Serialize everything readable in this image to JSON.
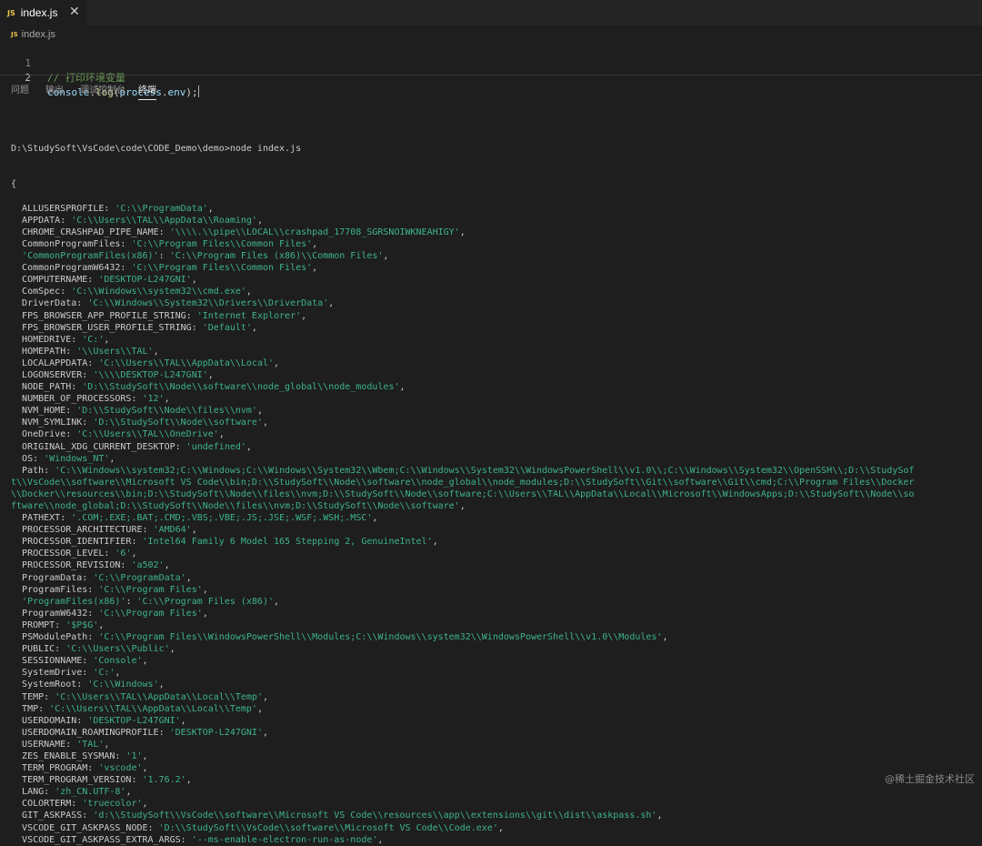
{
  "tab": {
    "badge": "JS",
    "label": "index.js",
    "close": "✕"
  },
  "breadcrumb": {
    "badge": "JS",
    "label": "index.js"
  },
  "editor": {
    "line1_num": "1",
    "line1_text": "// 打印环境变量",
    "line2_num": "2",
    "line2_ident": "console",
    "line2_dot": ".",
    "line2_func": "log",
    "line2_open": "(",
    "line2_arg_obj": "process",
    "line2_arg_dot": ".",
    "line2_arg_prop": "env",
    "line2_close": ");"
  },
  "panel": {
    "tabs": [
      "问题",
      "输出",
      "调试控制台",
      "终端"
    ],
    "active_tab": "终端"
  },
  "terminal": {
    "command": "D:\\StudySoft\\VsCode\\code\\CODE_Demo\\demo>node index.js",
    "open_brace": "{",
    "entries": [
      {
        "k": "ALLUSERSPROFILE",
        "v": "'C:\\\\ProgramData'"
      },
      {
        "k": "APPDATA",
        "v": "'C:\\\\Users\\\\TAL\\\\AppData\\\\Roaming'"
      },
      {
        "k": "CHROME_CRASHPAD_PIPE_NAME",
        "v": "'\\\\\\\\.\\\\pipe\\\\LOCAL\\\\crashpad_17708_SGRSNOIWKNEAHIGY'"
      },
      {
        "k": "CommonProgramFiles",
        "v": "'C:\\\\Program Files\\\\Common Files'"
      },
      {
        "k": "'CommonProgramFiles(x86)'",
        "v": "'C:\\\\Program Files (x86)\\\\Common Files'",
        "kq": true
      },
      {
        "k": "CommonProgramW6432",
        "v": "'C:\\\\Program Files\\\\Common Files'"
      },
      {
        "k": "COMPUTERNAME",
        "v": "'DESKTOP-L247GNI'"
      },
      {
        "k": "ComSpec",
        "v": "'C:\\\\Windows\\\\system32\\\\cmd.exe'"
      },
      {
        "k": "DriverData",
        "v": "'C:\\\\Windows\\\\System32\\\\Drivers\\\\DriverData'"
      },
      {
        "k": "FPS_BROWSER_APP_PROFILE_STRING",
        "v": "'Internet Explorer'"
      },
      {
        "k": "FPS_BROWSER_USER_PROFILE_STRING",
        "v": "'Default'"
      },
      {
        "k": "HOMEDRIVE",
        "v": "'C:'"
      },
      {
        "k": "HOMEPATH",
        "v": "'\\\\Users\\\\TAL'"
      },
      {
        "k": "LOCALAPPDATA",
        "v": "'C:\\\\Users\\\\TAL\\\\AppData\\\\Local'"
      },
      {
        "k": "LOGONSERVER",
        "v": "'\\\\\\\\DESKTOP-L247GNI'"
      },
      {
        "k": "NODE_PATH",
        "v": "'D:\\\\StudySoft\\\\Node\\\\software\\\\node_global\\\\node_modules'"
      },
      {
        "k": "NUMBER_OF_PROCESSORS",
        "v": "'12'"
      },
      {
        "k": "NVM_HOME",
        "v": "'D:\\\\StudySoft\\\\Node\\\\files\\\\nvm'"
      },
      {
        "k": "NVM_SYMLINK",
        "v": "'D:\\\\StudySoft\\\\Node\\\\software'"
      },
      {
        "k": "OneDrive",
        "v": "'C:\\\\Users\\\\TAL\\\\OneDrive'"
      },
      {
        "k": "ORIGINAL_XDG_CURRENT_DESKTOP",
        "v": "'undefined'"
      },
      {
        "k": "OS",
        "v": "'Windows_NT'"
      },
      {
        "k": "Path",
        "v": "'C:\\\\Windows\\\\system32;C:\\\\Windows;C:\\\\Windows\\\\System32\\\\Wbem;C:\\\\Windows\\\\System32\\\\WindowsPowerShell\\\\v1.0\\\\;C:\\\\Windows\\\\System32\\\\OpenSSH\\\\;D:\\\\StudySof",
        "cont": [
          "t\\\\VsCode\\\\software\\\\Microsoft VS Code\\\\bin;D:\\\\StudySoft\\\\Node\\\\software\\\\node_global\\\\node_modules;D:\\\\StudySoft\\\\Git\\\\software\\\\Git\\\\cmd;C:\\\\Program Files\\\\Docker",
          "\\\\Docker\\\\resources\\\\bin;D:\\\\StudySoft\\\\Node\\\\files\\\\nvm;D:\\\\StudySoft\\\\Node\\\\software;C:\\\\Users\\\\TAL\\\\AppData\\\\Local\\\\Microsoft\\\\WindowsApps;D:\\\\StudySoft\\\\Node\\\\so",
          "ftware\\\\node_global;D:\\\\StudySoft\\\\Node\\\\files\\\\nvm;D:\\\\StudySoft\\\\Node\\\\software'"
        ]
      },
      {
        "k": "PATHEXT",
        "v": "'.COM;.EXE;.BAT;.CMD;.VBS;.VBE;.JS;.JSE;.WSF;.WSH;.MSC'"
      },
      {
        "k": "PROCESSOR_ARCHITECTURE",
        "v": "'AMD64'"
      },
      {
        "k": "PROCESSOR_IDENTIFIER",
        "v": "'Intel64 Family 6 Model 165 Stepping 2, GenuineIntel'"
      },
      {
        "k": "PROCESSOR_LEVEL",
        "v": "'6'"
      },
      {
        "k": "PROCESSOR_REVISION",
        "v": "'a502'"
      },
      {
        "k": "ProgramData",
        "v": "'C:\\\\ProgramData'"
      },
      {
        "k": "ProgramFiles",
        "v": "'C:\\\\Program Files'"
      },
      {
        "k": "'ProgramFiles(x86)'",
        "v": "'C:\\\\Program Files (x86)'",
        "kq": true
      },
      {
        "k": "ProgramW6432",
        "v": "'C:\\\\Program Files'"
      },
      {
        "k": "PROMPT",
        "v": "'$P$G'"
      },
      {
        "k": "PSModulePath",
        "v": "'C:\\\\Program Files\\\\WindowsPowerShell\\\\Modules;C:\\\\Windows\\\\system32\\\\WindowsPowerShell\\\\v1.0\\\\Modules'"
      },
      {
        "k": "PUBLIC",
        "v": "'C:\\\\Users\\\\Public'"
      },
      {
        "k": "SESSIONNAME",
        "v": "'Console'"
      },
      {
        "k": "SystemDrive",
        "v": "'C:'"
      },
      {
        "k": "SystemRoot",
        "v": "'C:\\\\Windows'"
      },
      {
        "k": "TEMP",
        "v": "'C:\\\\Users\\\\TAL\\\\AppData\\\\Local\\\\Temp'"
      },
      {
        "k": "TMP",
        "v": "'C:\\\\Users\\\\TAL\\\\AppData\\\\Local\\\\Temp'"
      },
      {
        "k": "USERDOMAIN",
        "v": "'DESKTOP-L247GNI'"
      },
      {
        "k": "USERDOMAIN_ROAMINGPROFILE",
        "v": "'DESKTOP-L247GNI'"
      },
      {
        "k": "USERNAME",
        "v": "'TAL'"
      },
      {
        "k": "ZES_ENABLE_SYSMAN",
        "v": "'1'"
      },
      {
        "k": "TERM_PROGRAM",
        "v": "'vscode'"
      },
      {
        "k": "TERM_PROGRAM_VERSION",
        "v": "'1.76.2'"
      },
      {
        "k": "LANG",
        "v": "'zh_CN.UTF-8'"
      },
      {
        "k": "COLORTERM",
        "v": "'truecolor'"
      },
      {
        "k": "GIT_ASKPASS",
        "v": "'d:\\\\StudySoft\\\\VsCode\\\\software\\\\Microsoft VS Code\\\\resources\\\\app\\\\extensions\\\\git\\\\dist\\\\askpass.sh'"
      },
      {
        "k": "VSCODE_GIT_ASKPASS_NODE",
        "v": "'D:\\\\StudySoft\\\\VsCode\\\\software\\\\Microsoft VS Code\\\\Code.exe'"
      },
      {
        "k": "VSCODE_GIT_ASKPASS_EXTRA_ARGS",
        "v": "'--ms-enable-electron-run-as-node'"
      }
    ]
  },
  "watermark": "@稀土掘金技术社区",
  "colors": {
    "string": "#3db48b",
    "comment": "#6a9955",
    "identifier": "#9cdcfe",
    "function": "#dcdcaa",
    "js_badge": "#e8c34a"
  },
  "icons": {
    "tab_file": "js-file-icon",
    "tab_close": "close-icon"
  }
}
